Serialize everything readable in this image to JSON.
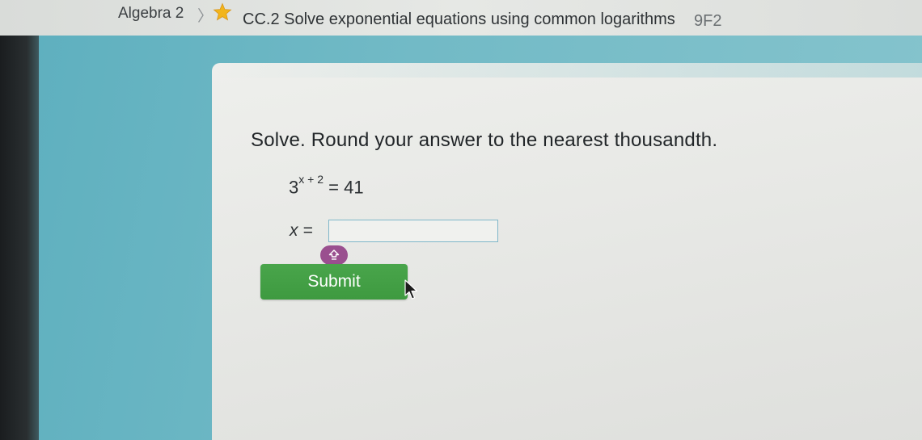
{
  "breadcrumb": {
    "subject": "Algebra 2",
    "separator": "〉",
    "skill_title": "CC.2 Solve exponential equations using common logarithms",
    "skill_code": "9F2"
  },
  "question": {
    "instruction": "Solve. Round your answer to the nearest thousandth.",
    "equation_base": "3",
    "equation_exponent": "x + 2",
    "equation_rhs": "= 41",
    "answer_label": "x =",
    "answer_value": ""
  },
  "actions": {
    "submit_label": "Submit"
  },
  "icons": {
    "star": "star-icon",
    "keyboard": "keyboard-toggle-icon",
    "cursor": "mouse-cursor-icon"
  },
  "colors": {
    "teal_background": "#6fb8c5",
    "submit_green": "#45a047",
    "star_gold": "#f2b51b",
    "keyboard_purple": "#9a4f8f",
    "input_border": "#7fb7c9"
  }
}
